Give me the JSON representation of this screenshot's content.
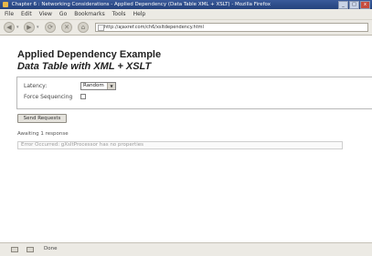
{
  "window": {
    "title": "Chapter 6 : Networking Considerations - Applied Dependency (Data Table XML + XSLT) - Mozilla Firefox",
    "minimize": "_",
    "maximize": "□",
    "close": "x"
  },
  "menu": [
    "File",
    "Edit",
    "View",
    "Go",
    "Bookmarks",
    "Tools",
    "Help"
  ],
  "nav": {
    "back_glyph": "◀",
    "forward_glyph": "▶",
    "dropdown_glyph": "▾",
    "refresh_glyph": "⟳",
    "stop_glyph": "✕",
    "home_glyph": "⌂",
    "url": "http://ajaxref.com/ch6/xsltdependency.html"
  },
  "page": {
    "heading": "Applied Dependency Example",
    "subheading": "Data Table with XML + XSLT",
    "latency_label": "Latency:",
    "latency_value": "Random",
    "force_sequencing_label": "Force Sequencing",
    "send_button": "Send Requests",
    "status": "Awaiting 1 response",
    "error": "Error Occurred: gXsltProcessor has no properties"
  },
  "statusbar": {
    "text": "Done"
  },
  "icons": {
    "select_arrow": "▼"
  }
}
